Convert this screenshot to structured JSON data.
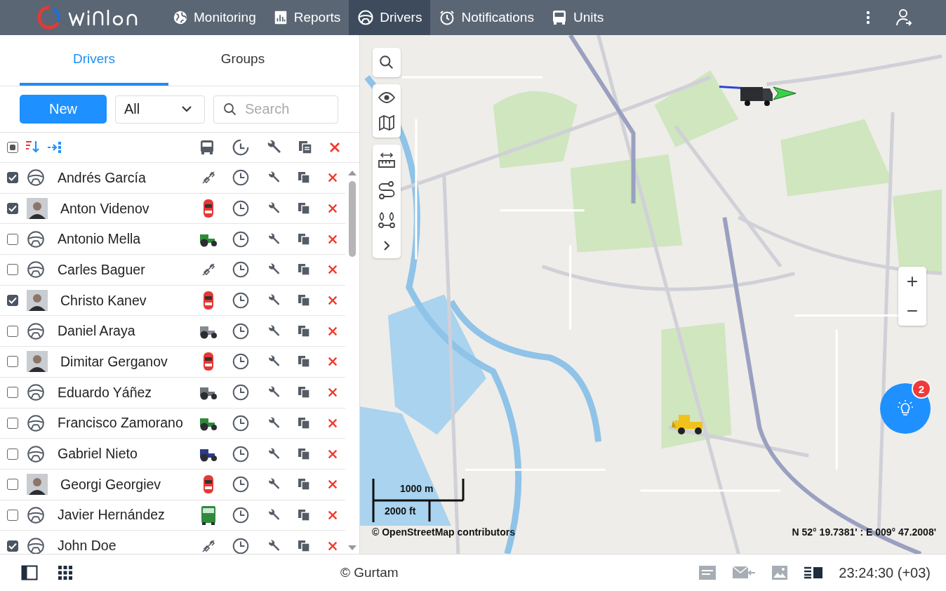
{
  "header": {
    "nav": [
      {
        "label": "Monitoring",
        "selected": false
      },
      {
        "label": "Reports",
        "selected": false
      },
      {
        "label": "Drivers",
        "selected": true
      },
      {
        "label": "Notifications",
        "selected": false
      },
      {
        "label": "Units",
        "selected": false
      }
    ]
  },
  "tabs": [
    {
      "label": "Drivers",
      "selected": true
    },
    {
      "label": "Groups",
      "selected": false
    }
  ],
  "toolbar": {
    "new_button": "New",
    "filter": {
      "value": "All"
    },
    "search": {
      "placeholder": "Search"
    }
  },
  "select_all": {
    "partial": true
  },
  "drivers": [
    {
      "name": "Andrés García",
      "checked": true,
      "avatar": {
        "kind": "wheel"
      },
      "unit": {
        "kind": "none"
      }
    },
    {
      "name": "Anton Videnov",
      "checked": true,
      "unit": {
        "kind": "car",
        "color": "#e53935"
      }
    },
    {
      "name": "Antonio Mella",
      "checked": false,
      "avatar": {
        "kind": "wheel"
      },
      "unit": {
        "kind": "tractor",
        "color": "#2e8b3a"
      }
    },
    {
      "name": "Carles Baguer",
      "checked": false,
      "avatar": {
        "kind": "wheel"
      },
      "unit": {
        "kind": "none"
      }
    },
    {
      "name": "Christo Kanev",
      "checked": true,
      "unit": {
        "kind": "car",
        "color": "#e53935"
      }
    },
    {
      "name": "Daniel Araya",
      "checked": false,
      "avatar": {
        "kind": "wheel"
      },
      "unit": {
        "kind": "tractor",
        "color": "#858a91"
      }
    },
    {
      "name": "Dimitar Gerganov",
      "checked": false,
      "unit": {
        "kind": "car",
        "color": "#e53935"
      }
    },
    {
      "name": "Eduardo Yáñez",
      "checked": false,
      "avatar": {
        "kind": "wheel"
      },
      "unit": {
        "kind": "tractor",
        "color": "#6f747b"
      }
    },
    {
      "name": "Francisco Zamorano",
      "checked": false,
      "avatar": {
        "kind": "wheel"
      },
      "unit": {
        "kind": "tractor",
        "color": "#2e8b3a"
      }
    },
    {
      "name": "Gabriel Nieto",
      "checked": false,
      "avatar": {
        "kind": "wheel"
      },
      "unit": {
        "kind": "tractor",
        "color": "#2d3a8c"
      }
    },
    {
      "name": "Georgi Georgiev",
      "checked": false,
      "unit": {
        "kind": "car",
        "color": "#e53935"
      }
    },
    {
      "name": "Javier Hernández",
      "checked": false,
      "avatar": {
        "kind": "wheel"
      },
      "unit": {
        "kind": "truck",
        "color": "#2e8b3a"
      }
    },
    {
      "name": "John Doe",
      "checked": true,
      "avatar": {
        "kind": "wheel"
      },
      "unit": {
        "kind": "none"
      }
    }
  ],
  "map": {
    "zoom_in": "+",
    "zoom_out": "−",
    "notification_count": "2",
    "scale_metric": "1000 m",
    "scale_imperial": "2000 ft",
    "attribution": "© OpenStreetMap contributors",
    "coordinates": "N 52° 19.7381' : E 009° 47.2008'"
  },
  "footer": {
    "copyright": "© Gurtam",
    "time": "23:24:30 (+03)"
  }
}
